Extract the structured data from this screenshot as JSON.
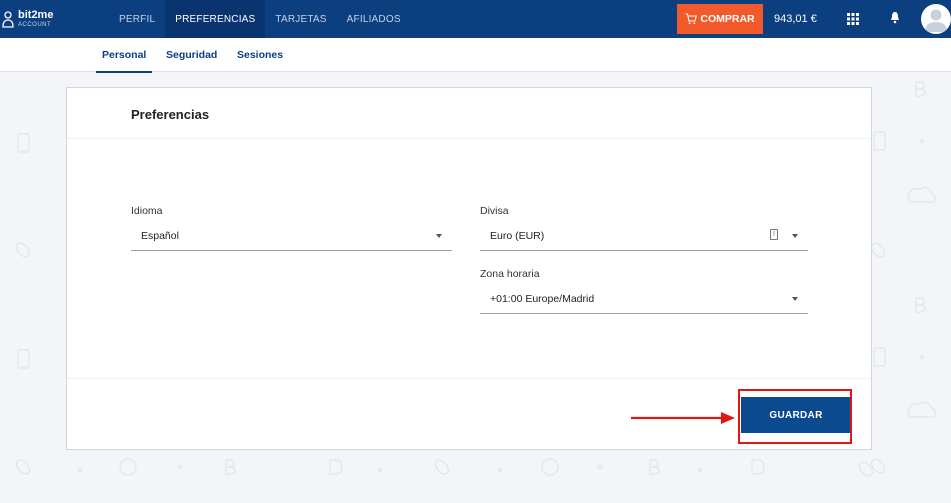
{
  "logo": {
    "brand": "bit2me",
    "sub": "ACCOUNT"
  },
  "nav": {
    "items": [
      {
        "label": "PERFIL",
        "active": false
      },
      {
        "label": "PREFERENCIAS",
        "active": true
      },
      {
        "label": "TARJETAS",
        "active": false
      },
      {
        "label": "AFILIADOS",
        "active": false
      }
    ]
  },
  "header": {
    "buy_label": "COMPRAR",
    "balance": "943,01 €",
    "buy_color": "#f35a2b",
    "brand_color": "#0b3f7f"
  },
  "subnav": {
    "tabs": [
      {
        "label": "Personal",
        "active": true
      },
      {
        "label": "Seguridad",
        "active": false
      },
      {
        "label": "Sesiones",
        "active": false
      }
    ]
  },
  "card": {
    "title": "Preferencias",
    "language": {
      "label": "Idioma",
      "value": "Español"
    },
    "currency": {
      "label": "Divisa",
      "value": "Euro (EUR)"
    },
    "timezone": {
      "label": "Zona horaria",
      "value": "+01:00 Europe/Madrid"
    },
    "save_label": "GUARDAR"
  },
  "icons": {
    "cart": "cart-icon",
    "apps": "apps-grid-icon",
    "bell": "bell-icon",
    "avatar": "user-avatar-icon"
  }
}
